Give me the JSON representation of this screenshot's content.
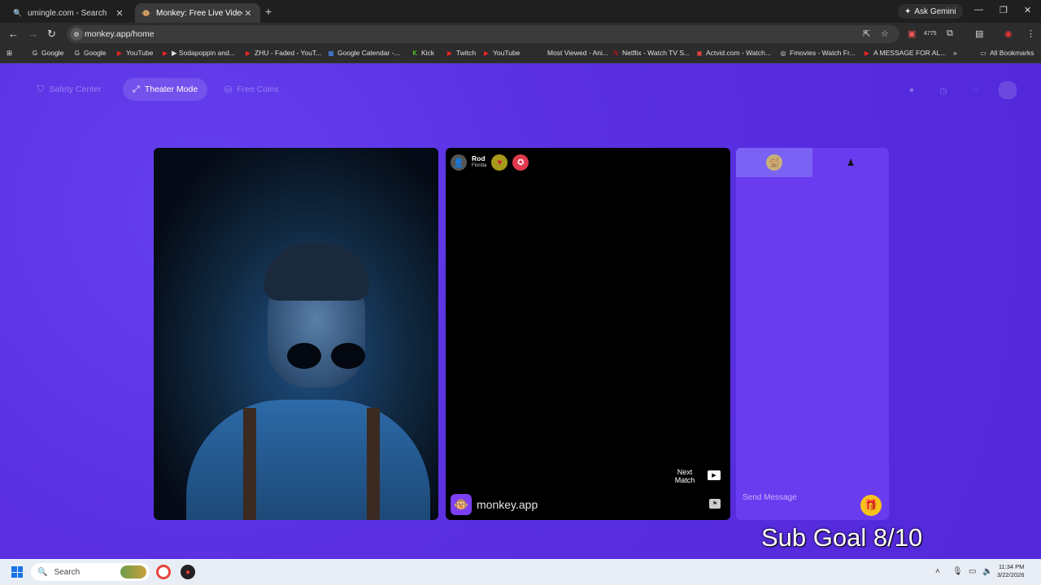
{
  "browser": {
    "tabs": [
      {
        "title": "umingle.com - Search",
        "icon": "search-icon"
      },
      {
        "title": "Monkey: Free Live Video Ch",
        "icon": "monkey-icon",
        "active": true
      }
    ],
    "ask_gemini": "Ask Gemini",
    "url": "monkey.app/home",
    "bookmarks": [
      {
        "label": "Google",
        "icon": "google-icon"
      },
      {
        "label": "Google",
        "icon": "google-icon"
      },
      {
        "label": "YouTube",
        "icon": "youtube-icon"
      },
      {
        "label": "▶ Sodapoppin and...",
        "icon": "youtube-icon"
      },
      {
        "label": "ZHU - Faded - YouT...",
        "icon": "youtube-icon"
      },
      {
        "label": "Google Calendar -...",
        "icon": "calendar-icon"
      },
      {
        "label": "Kick",
        "icon": "kick-icon"
      },
      {
        "label": "Twitch",
        "icon": "youtube-icon"
      },
      {
        "label": "YouTube",
        "icon": "youtube-icon"
      },
      {
        "label": "Most Viewed - Ani...",
        "icon": "page-icon"
      },
      {
        "label": "Netflix - Watch TV S...",
        "icon": "netflix-icon"
      },
      {
        "label": "Actvid.com - Watch...",
        "icon": "video-icon"
      },
      {
        "label": "Fmovies - Watch Fr...",
        "icon": "globe-icon"
      },
      {
        "label": "A MESSAGE FOR AL...",
        "icon": "youtube-icon"
      }
    ],
    "all_bookmarks": "All Bookmarks",
    "extension_badge": "4775"
  },
  "page": {
    "safety_center": "Safety Center",
    "theater_mode": "Theater Mode",
    "free_coins": "Free Coins",
    "remote_user": {
      "name": "Rod",
      "location": "Florida"
    },
    "next_match": "Next Match",
    "brand": "monkey.app",
    "send_placeholder": "Send Message",
    "sub_goal": "Sub Goal 8/10"
  },
  "taskbar": {
    "search_label": "Search",
    "time": "11:34 PM",
    "date": "3/22/2026"
  },
  "colors": {
    "page_bg": "#5b2fe0",
    "panel": "#6a3cf0",
    "gift": "#f7c21a"
  }
}
